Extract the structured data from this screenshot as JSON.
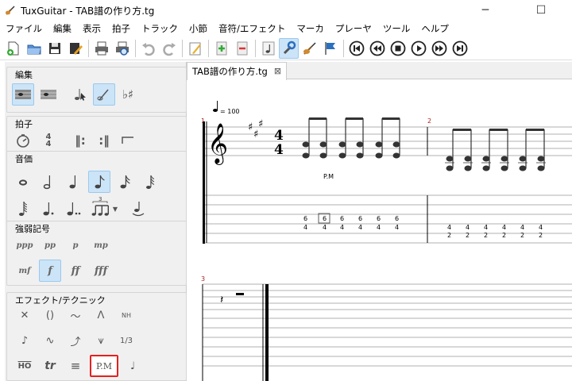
{
  "window": {
    "title": "TuxGuitar - TAB譜の作り方.tg",
    "minimize": "─",
    "maximize": "☐"
  },
  "menu": [
    "ファイル",
    "編集",
    "表示",
    "拍子",
    "トラック",
    "小節",
    "音符/エフェクト",
    "マーカ",
    "プレーヤ",
    "ツール",
    "ヘルプ"
  ],
  "toolbar_icons": [
    "new-file",
    "open-file",
    "save-file",
    "edit-file",
    "print",
    "print-preview",
    "undo",
    "redo",
    "edit-mode",
    "add-measure",
    "remove-measure",
    "note-mode",
    "settings",
    "guitar",
    "flag",
    "first",
    "previous",
    "stop",
    "play",
    "next",
    "last"
  ],
  "panel": {
    "edit": {
      "title": "編集"
    },
    "time": {
      "title": "拍子"
    },
    "duration": {
      "title": "音価",
      "tuplet": "3"
    },
    "dynamics": {
      "title": "強弱記号",
      "row1": [
        "ppp",
        "pp",
        "p",
        "mp"
      ],
      "row2": [
        "mf",
        "f",
        "ff",
        "fff"
      ]
    },
    "effects": {
      "title": "エフェクト/テクニック",
      "row1": [
        "✕",
        "()",
        "～",
        "ᐱ",
        "NH"
      ],
      "row2": [
        "♪",
        "∿",
        "⤴",
        "⩛",
        "1/3"
      ],
      "row3": [
        "HO",
        "tr",
        "≡",
        "P.M",
        "♩"
      ]
    }
  },
  "tab": {
    "label": "TAB譜の作り方.tg",
    "close": "⊠"
  },
  "score": {
    "tempo": "= 100",
    "time_sig_top": "4",
    "time_sig_bottom": "4",
    "measure_numbers": [
      "1",
      "2",
      "3"
    ],
    "palm_mute": "P.M",
    "m1_tab_top": [
      "6",
      "6",
      "6",
      "6",
      "6",
      "6"
    ],
    "m1_tab_bottom": [
      "4",
      "4",
      "4",
      "4",
      "4",
      "4"
    ],
    "m2_tab_top": [
      "4",
      "4",
      "4",
      "4",
      "4",
      "4"
    ],
    "m2_tab_bottom": [
      "2",
      "2",
      "2",
      "2",
      "2",
      "2"
    ]
  },
  "colors": {
    "selection": "#cce4f7",
    "highlight": "#e52020",
    "measure_number": "#b02020"
  }
}
